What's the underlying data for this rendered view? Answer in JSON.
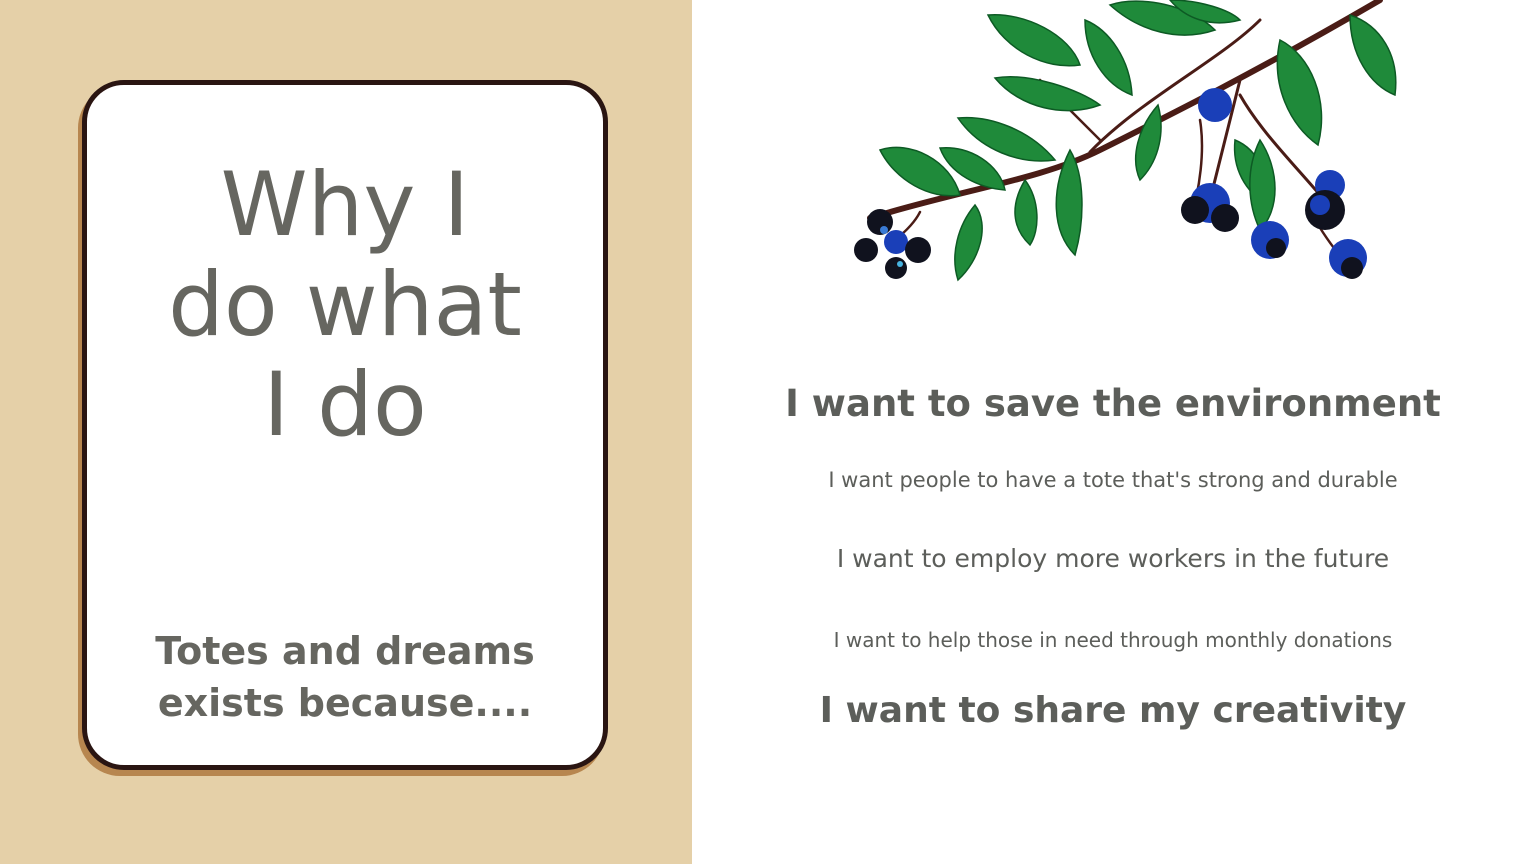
{
  "card": {
    "title_lines": [
      "Why I",
      "do what",
      "I do"
    ],
    "subtitle_lines": [
      "Totes and dreams",
      "exists because...."
    ]
  },
  "reasons": [
    "I want to save the environment",
    "I want people to have a tote that's strong and durable",
    "I want to employ more workers in the future",
    "I want to help those in need through monthly donations",
    "I want to share my creativity"
  ],
  "decoration": {
    "image": "berry-branch-illustration",
    "colors": {
      "leaf": "#1f8a3a",
      "berry": "#1a3fb8",
      "branch": "#4a1c16"
    }
  },
  "colors": {
    "left_background": "#e5d0a8",
    "card_border": "#2a1512",
    "text": "#5c5e5a"
  }
}
